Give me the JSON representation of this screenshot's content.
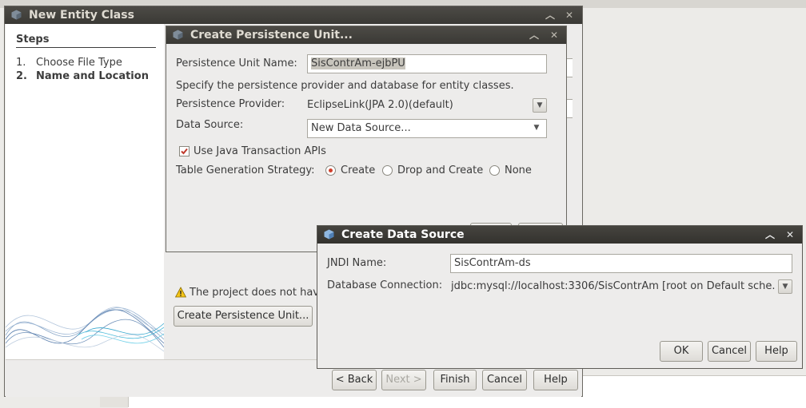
{
  "wizard": {
    "title": "New Entity Class",
    "steps_heading": "Steps",
    "steps": [
      {
        "num": "1.",
        "label": "Choose File Type"
      },
      {
        "num": "2.",
        "label": "Name and Location"
      }
    ],
    "warning_text": "The project does not hav",
    "create_pu_button": "Create Persistence Unit...",
    "back_button": "< Back",
    "next_button": "Next >",
    "finish_button": "Finish",
    "cancel_button": "Cancel",
    "help_button": "Help"
  },
  "persistence_unit_dialog": {
    "title": "Create Persistence Unit...",
    "pu_name_label": "Persistence Unit Name:",
    "pu_name_value": "SisContrAm-ejbPU",
    "description": "Specify the persistence provider and database for entity classes.",
    "provider_label": "Persistence Provider:",
    "provider_value": "EclipseLink(JPA 2.0)(default)",
    "datasource_label": "Data Source:",
    "datasource_value": "New Data Source...",
    "jta_label": "Use Java Transaction APIs",
    "jta_checked": true,
    "strategy_label": "Table Generation Strategy:",
    "strategy_options": [
      "Create",
      "Drop and Create",
      "None"
    ],
    "strategy_selected": "Create"
  },
  "datasource_dialog": {
    "title": "Create Data Source",
    "jndi_label": "JNDI Name:",
    "jndi_value": "SisContrAm-ds",
    "connection_label": "Database Connection:",
    "connection_value": "jdbc:mysql://localhost:3306/SisContrAm [root on Default sche...",
    "ok_button": "OK",
    "cancel_button": "Cancel",
    "help_button": "Help"
  }
}
